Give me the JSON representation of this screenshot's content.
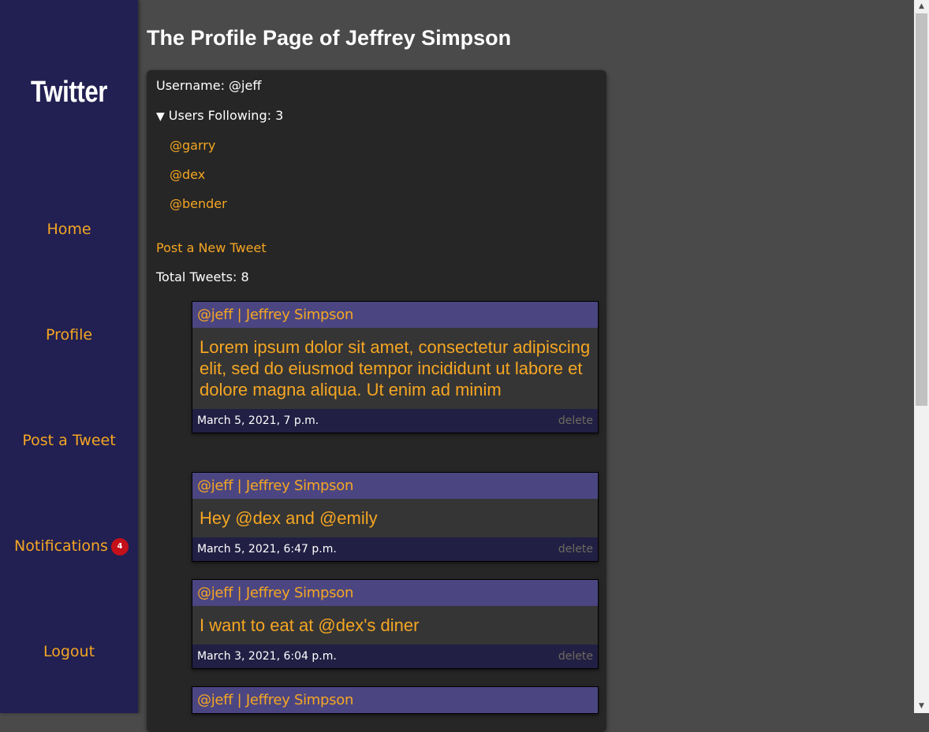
{
  "sidebar": {
    "brand": "Twitter",
    "nav": {
      "home": "Home",
      "profile": "Profile",
      "post": "Post a Tweet",
      "notifications": "Notifications",
      "notifications_count": "4",
      "logout": "Logout"
    }
  },
  "page": {
    "title": "The Profile Page of Jeffrey Simpson"
  },
  "profile": {
    "username_label": "Username: @jeff",
    "following_label": "Users Following: 3",
    "following": [
      "@garry",
      "@dex",
      "@bender"
    ],
    "post_link": "Post a New Tweet",
    "total_tweets": "Total Tweets: 8"
  },
  "tweets": [
    {
      "header": "@jeff | Jeffrey Simpson",
      "body": "Lorem ipsum dolor sit amet, consectetur adipiscing elit, sed do eiusmod tempor incididunt ut labore et dolore magna aliqua. Ut enim ad minim",
      "date": "March 5, 2021, 7 p.m.",
      "delete": "delete"
    },
    {
      "header": "@jeff | Jeffrey Simpson",
      "body": "Hey @dex and @emily",
      "date": "March 5, 2021, 6:47 p.m.",
      "delete": "delete"
    },
    {
      "header": "@jeff | Jeffrey Simpson",
      "body": "I want to eat at @dex's diner",
      "date": "March 3, 2021, 6:04 p.m.",
      "delete": "delete"
    },
    {
      "header": "@jeff | Jeffrey Simpson",
      "body": "",
      "date": "",
      "delete": ""
    }
  ],
  "colors": {
    "sidebar_bg": "#222052",
    "accent": "#f5a623",
    "tweet_header_bg": "#4b4682",
    "tweet_footer_bg": "#221f44",
    "badge_bg": "#c4101a"
  },
  "icons": {
    "following_toggle": "triangle-down-icon",
    "scroll_up": "scroll-up-arrow-icon",
    "scroll_down": "scroll-down-arrow-icon"
  }
}
